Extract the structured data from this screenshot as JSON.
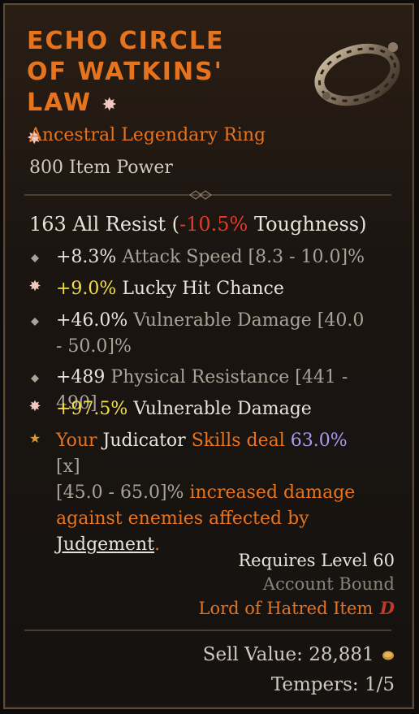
{
  "item": {
    "title": "ECHO CIRCLE OF WATKINS' LAW",
    "type_line": "Ancestral Legendary Ring",
    "power_line": "800 Item Power"
  },
  "resist": {
    "prefix": "163 All Resist (",
    "value": "-10.5%",
    "suffix": " Toughness)"
  },
  "affixes": [
    {
      "value": "+8.3%",
      "label": " Attack Speed ",
      "range": "[8.3 - 10.0]%"
    },
    {
      "value": "+9.0%",
      "label": " Lucky Hit Chance"
    },
    {
      "value": "+46.0%",
      "label": " Vulnerable Damage ",
      "range": "[40.0 - 50.0]%"
    },
    {
      "value": "+489",
      "label": " Physical Resistance ",
      "range": "[441 - 490]"
    },
    {
      "value": "+97.5%",
      "label": " Vulnerable Damage"
    }
  ],
  "aspect": {
    "t1": "Your ",
    "t2": "Judicator",
    "t3": " Skills deal ",
    "t4": "63.0%",
    "t5": "[x]",
    "t6": "[45.0 - 65.0]%",
    "t7": " increased damage against enemies affected by ",
    "t8": "Judgement",
    "t9": "."
  },
  "footer": {
    "requires": "Requires Level 60",
    "bound": "Account Bound",
    "expansion": "Lord of Hatred Item",
    "sell": "Sell Value: 28,881",
    "tempers": "Tempers: 1/5"
  },
  "colors": {
    "legendary": "#e6741f",
    "greater_affix": "#f2e048",
    "negative": "#e23a2a",
    "aspect_value": "#a79af0"
  },
  "icons": [
    "greater-affix-star-icon",
    "affix-diamond-icon",
    "aspect-star-icon",
    "gold-coin-icon",
    "expansion-logo-icon",
    "ring-item-image"
  ]
}
